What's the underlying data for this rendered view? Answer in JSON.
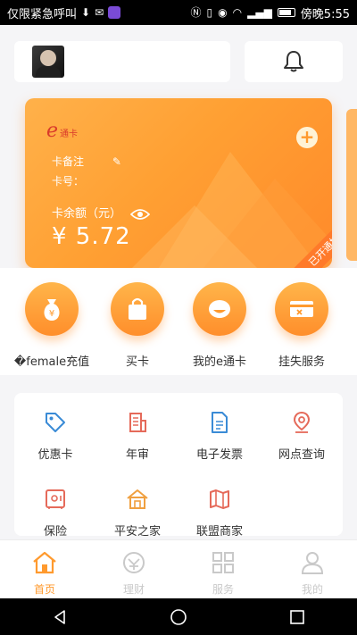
{
  "status_bar": {
    "left_text": "仅限紧急呼叫",
    "time_text": "傍晚5:55"
  },
  "header": {
    "avatar_alt": "",
    "bell_icon": "bell-icon"
  },
  "card": {
    "logo_e": "e",
    "logo_text": "通卡",
    "note_label": "卡备注",
    "card_no_label": "卡号：",
    "balance_label": "卡余额（元）",
    "balance_value": "¥ 5.72",
    "status_ribbon": "已开通挂失",
    "colors": {
      "gradient_start": "#ffb14a",
      "gradient_end": "#ff8a2a"
    }
  },
  "quick_actions": [
    {
      "label": "�female充值",
      "icon": "money-bag-icon"
    },
    {
      "label": "买卡",
      "icon": "shopping-bag-icon"
    },
    {
      "label": "我的e通卡",
      "icon": "card-face-icon"
    },
    {
      "label": "挂失服务",
      "icon": "card-cancel-icon"
    }
  ],
  "services": [
    {
      "label": "优惠卡",
      "icon": "tag-icon",
      "color": "#3a8bd6"
    },
    {
      "label": "年审",
      "icon": "building-icon",
      "color": "#e56a5a"
    },
    {
      "label": "电子发票",
      "icon": "document-icon",
      "color": "#3a8bd6"
    },
    {
      "label": "网点查询",
      "icon": "location-pin-icon",
      "color": "#e56a5a"
    },
    {
      "label": "保险",
      "icon": "safe-icon",
      "color": "#e56a5a"
    },
    {
      "label": "平安之家",
      "icon": "home-icon",
      "color": "#f0a040"
    },
    {
      "label": "联盟商家",
      "icon": "map-icon",
      "color": "#e56a5a"
    }
  ],
  "bottom_nav": [
    {
      "label": "首页",
      "icon": "home-icon",
      "active": true
    },
    {
      "label": "理财",
      "icon": "finance-icon",
      "active": false
    },
    {
      "label": "服务",
      "icon": "grid-icon",
      "active": false
    },
    {
      "label": "我的",
      "icon": "person-icon",
      "active": false
    }
  ]
}
